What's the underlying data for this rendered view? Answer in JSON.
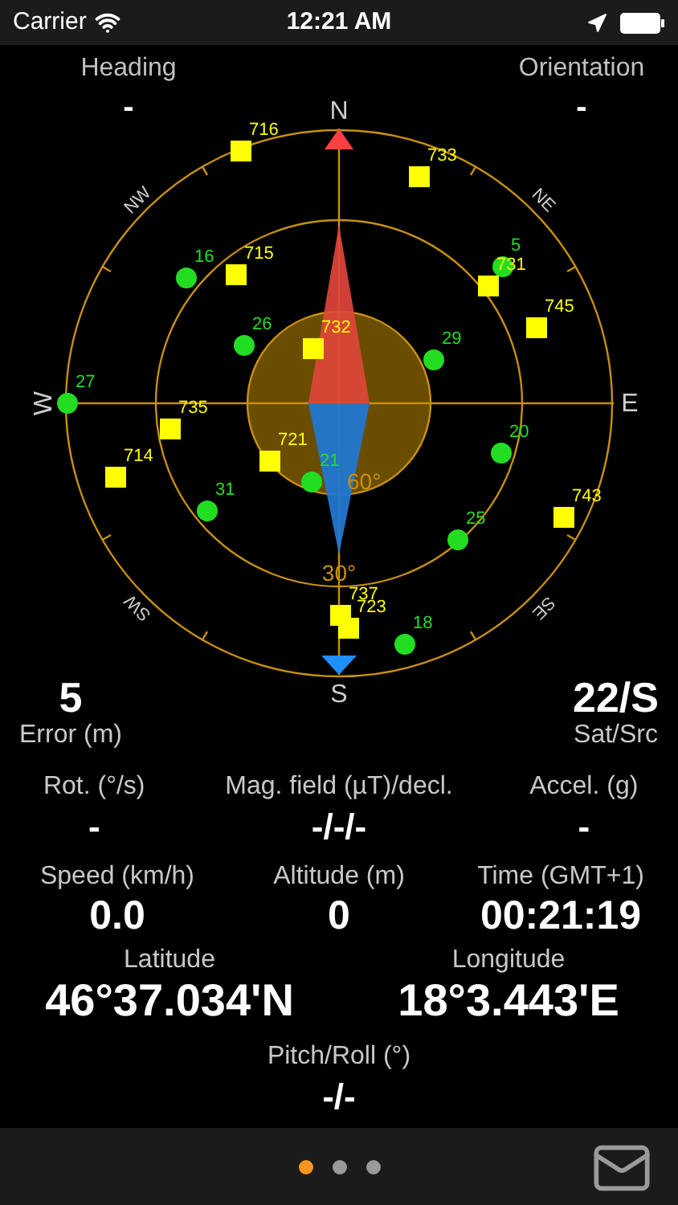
{
  "status_bar": {
    "carrier": "Carrier",
    "time": "12:21 AM"
  },
  "heading": {
    "label": "Heading",
    "value": "-"
  },
  "orientation": {
    "label": "Orientation",
    "value": "-"
  },
  "compass": {
    "directions": [
      "N",
      "NE",
      "E",
      "SE",
      "S",
      "SW",
      "W",
      "NW"
    ],
    "ring_labels": [
      "60°",
      "30°"
    ],
    "satellites": [
      {
        "label": "716",
        "kind": "square",
        "color": "#ffff00"
      },
      {
        "label": "733",
        "kind": "square",
        "color": "#ffff00"
      },
      {
        "label": "16",
        "kind": "dot",
        "color": "#22dd22"
      },
      {
        "label": "715",
        "kind": "square",
        "color": "#ffff00"
      },
      {
        "label": "5",
        "kind": "dot",
        "color": "#22dd22"
      },
      {
        "label": "731",
        "kind": "square",
        "color": "#ffff00"
      },
      {
        "label": "745",
        "kind": "square",
        "color": "#ffff00"
      },
      {
        "label": "26",
        "kind": "dot",
        "color": "#22dd22"
      },
      {
        "label": "732",
        "kind": "square",
        "color": "#ffff00"
      },
      {
        "label": "29",
        "kind": "dot",
        "color": "#22dd22"
      },
      {
        "label": "27",
        "kind": "dot",
        "color": "#22dd22"
      },
      {
        "label": "735",
        "kind": "square",
        "color": "#ffff00"
      },
      {
        "label": "714",
        "kind": "square",
        "color": "#ffff00"
      },
      {
        "label": "721",
        "kind": "square",
        "color": "#ffff00"
      },
      {
        "label": "21",
        "kind": "dot",
        "color": "#22dd22"
      },
      {
        "label": "20",
        "kind": "dot",
        "color": "#22dd22"
      },
      {
        "label": "31",
        "kind": "dot",
        "color": "#22dd22"
      },
      {
        "label": "743",
        "kind": "square",
        "color": "#ffff00"
      },
      {
        "label": "25",
        "kind": "dot",
        "color": "#22dd22"
      },
      {
        "label": "737",
        "kind": "square",
        "color": "#ffff00"
      },
      {
        "label": "723",
        "kind": "square",
        "color": "#ffff00"
      },
      {
        "label": "18",
        "kind": "dot",
        "color": "#22dd22"
      }
    ]
  },
  "error": {
    "value": "5",
    "label": "Error (m)"
  },
  "sat_src": {
    "value": "22/S",
    "label": "Sat/Src"
  },
  "sensors": [
    {
      "label": "Rot. (°/s)",
      "value": "-"
    },
    {
      "label": "Mag. field (µT)/decl.",
      "value": "-/-/-"
    },
    {
      "label": "Accel. (g)",
      "value": "-"
    }
  ],
  "motion": [
    {
      "label": "Speed (km/h)",
      "value": "0.0"
    },
    {
      "label": "Altitude (m)",
      "value": "0"
    },
    {
      "label": "Time (GMT+1)",
      "value": "00:21:19"
    }
  ],
  "coordinates": [
    {
      "label": "Latitude",
      "value": "46°37.034'N"
    },
    {
      "label": "Longitude",
      "value": "18°3.443'E"
    }
  ],
  "pitch_roll": {
    "label": "Pitch/Roll (°)",
    "value": "-/-"
  },
  "page_dots": [
    {
      "selected": true
    },
    {
      "selected": false
    },
    {
      "selected": false
    }
  ]
}
